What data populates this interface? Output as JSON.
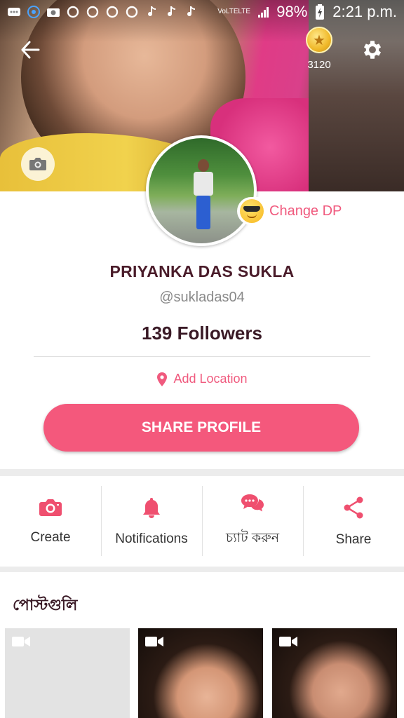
{
  "status_bar": {
    "battery": "98%",
    "time": "2:21 p.m.",
    "network_1": "VoLTE",
    "network_2": "LTE"
  },
  "header": {
    "coin_count": "3120"
  },
  "profile": {
    "name": "PRIYANKA DAS SUKLA",
    "username": "@sukladas04",
    "followers": "139 Followers",
    "change_dp_label": "Change DP",
    "add_location_label": "Add Location",
    "share_profile_label": "SHARE PROFILE"
  },
  "actions": [
    {
      "label": "Create",
      "icon": "camera-icon"
    },
    {
      "label": "Notifications",
      "icon": "bell-icon"
    },
    {
      "label": "চ্যাট করুন",
      "icon": "chat-icon"
    },
    {
      "label": "Share",
      "icon": "share-icon"
    }
  ],
  "posts": {
    "title": "পোস্টগুলি",
    "items": [
      {
        "type": "video",
        "icon": "video-icon"
      },
      {
        "type": "video",
        "icon": "video-icon"
      },
      {
        "type": "video",
        "icon": "video-icon"
      }
    ]
  },
  "colors": {
    "accent": "#f4587c",
    "accent_text": "#f05a7e",
    "name_text": "#4a1c2a"
  }
}
